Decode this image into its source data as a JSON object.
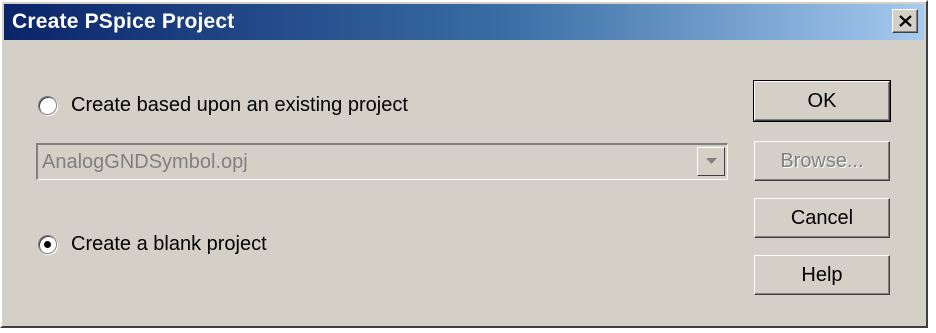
{
  "window": {
    "title": "Create PSpice Project",
    "close_icon": "close-icon"
  },
  "options": {
    "existing_label": "Create based upon an existing project",
    "existing_selected": false,
    "blank_label": "Create a blank project",
    "blank_selected": true
  },
  "project_combo": {
    "value": "AnalogGNDSymbol.opj",
    "enabled": false
  },
  "buttons": {
    "ok": "OK",
    "browse": "Browse...",
    "cancel": "Cancel",
    "help": "Help"
  },
  "colors": {
    "title_start": "#0a246a",
    "title_end": "#a6caf0",
    "face": "#d4d0c8"
  }
}
